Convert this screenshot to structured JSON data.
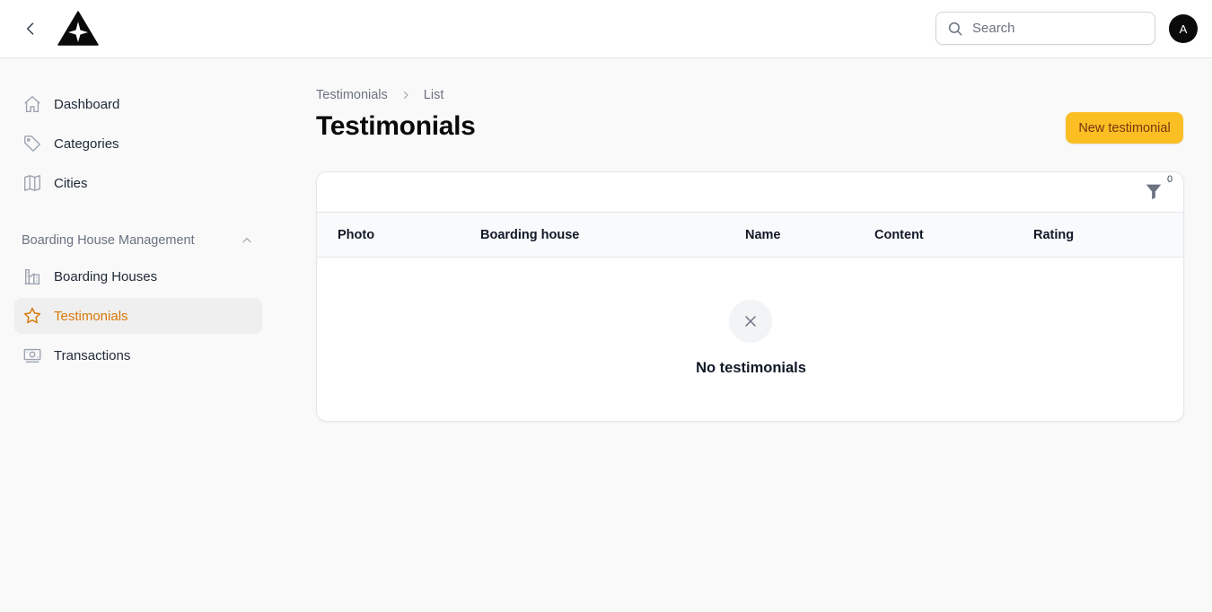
{
  "topbar": {
    "search": {
      "placeholder": "Search"
    },
    "avatar_initial": "A"
  },
  "sidebar": {
    "items": [
      {
        "label": "Dashboard",
        "icon": "home-icon"
      },
      {
        "label": "Categories",
        "icon": "tag-icon"
      },
      {
        "label": "Cities",
        "icon": "map-icon"
      }
    ],
    "group": {
      "label": "Boarding House Management",
      "expanded": true,
      "items": [
        {
          "label": "Boarding Houses",
          "icon": "building-icon"
        },
        {
          "label": "Testimonials",
          "icon": "star-icon",
          "active": true
        },
        {
          "label": "Transactions",
          "icon": "money-icon"
        }
      ]
    }
  },
  "breadcrumb": [
    "Testimonials",
    "List"
  ],
  "page": {
    "title": "Testimonials",
    "new_button_label": "New testimonial"
  },
  "table": {
    "filter_count": "0",
    "columns": [
      "Photo",
      "Boarding house",
      "Name",
      "Content",
      "Rating"
    ],
    "empty_text": "No testimonials"
  },
  "colors": {
    "accent": "#fbbf24",
    "active_text": "#d97706"
  }
}
